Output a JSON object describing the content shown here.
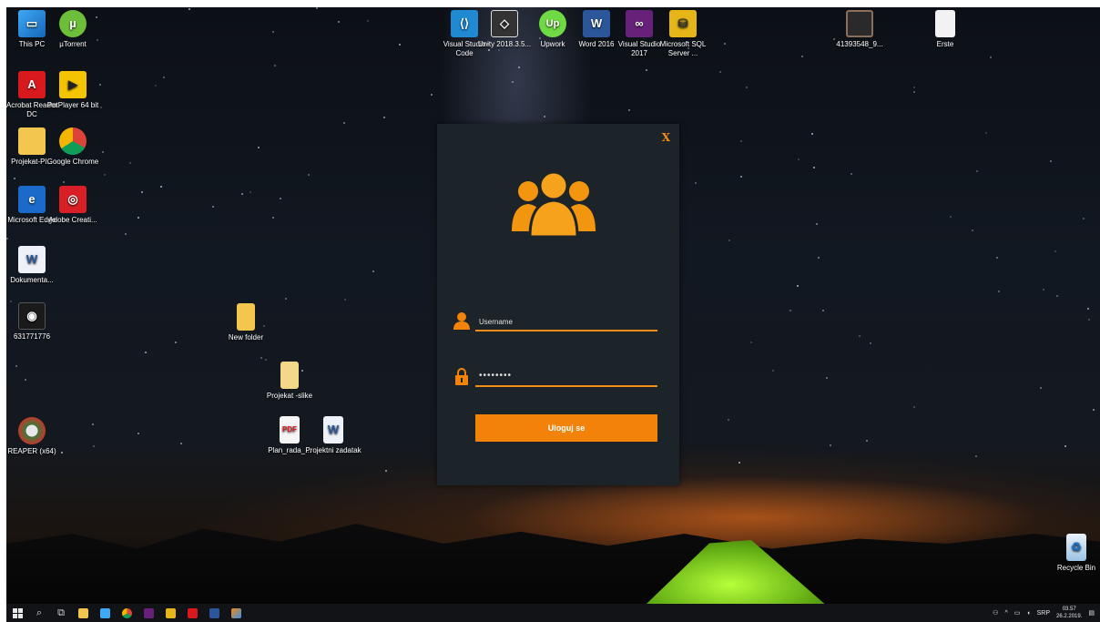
{
  "desktop_icons": {
    "this_pc": "This PC",
    "utorrent": "µTorrent",
    "acrobat": "Acrobat Reader DC",
    "potplayer": "PotPlayer 64 bit",
    "projekat_pl": "Projekat-Pl...",
    "chrome": "Google Chrome",
    "edge": "Microsoft Edge",
    "adobe_cc": "Adobe Creati...",
    "dokumenta": "Dokumenta...",
    "file_631": "631771776",
    "reaper": "REAPER (x64)",
    "vscode": "Visual Studio Code",
    "unity": "Unity 2018.3.5...",
    "upwork": "Upwork",
    "word": "Word 2016",
    "vs2017": "Visual Studio 2017",
    "sqlserver": "Microsoft SQL Server ...",
    "img_4139": "41393548_9...",
    "erste": "Erste",
    "new_folder": "New folder",
    "projekat_slike": "Projekat -slike",
    "plan_rada": "Plan_rada_...",
    "projektni": "Projektni zadatak",
    "recycle_bin": "Recycle Bin"
  },
  "login": {
    "close_label": "X",
    "username_placeholder": "Username",
    "password_mask": "••••••••",
    "button_label": "Uloguj se",
    "accent_color": "#f2820a"
  },
  "taskbar": {
    "language": "SRP",
    "time": "03.57",
    "date": "26.2.2019."
  }
}
